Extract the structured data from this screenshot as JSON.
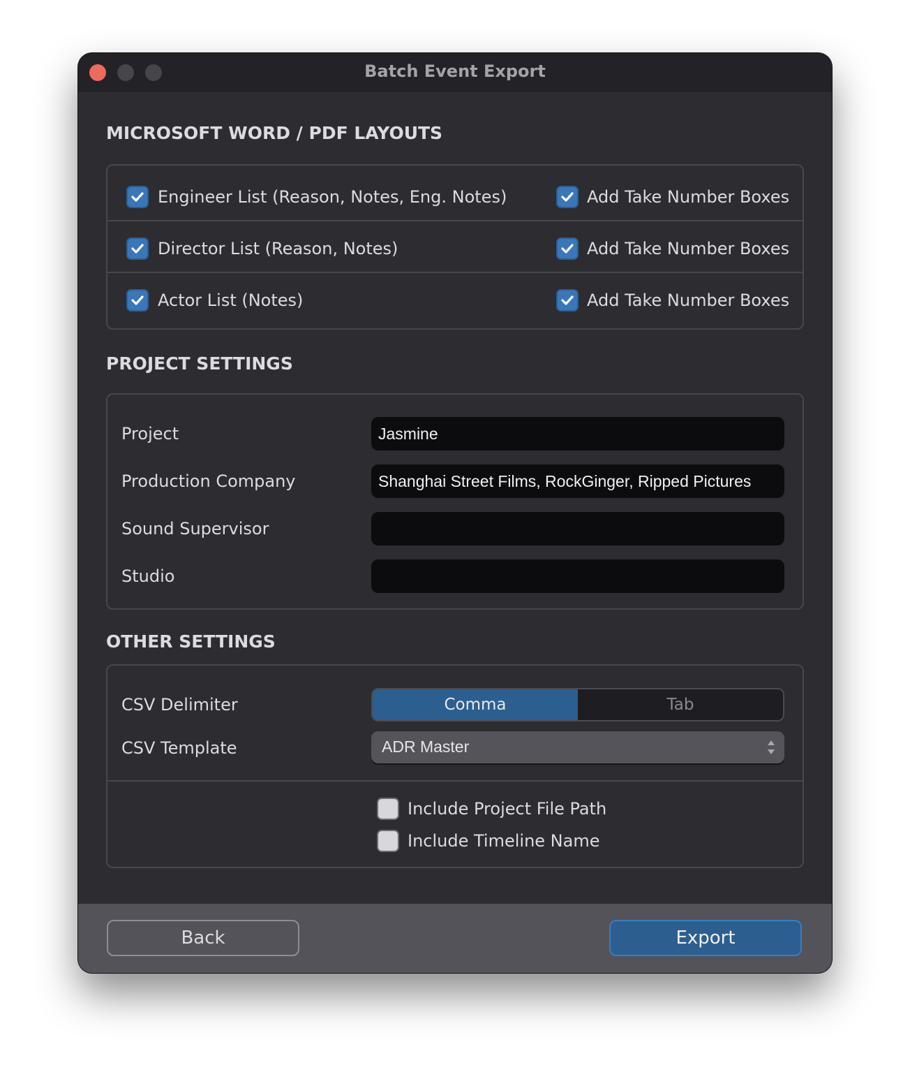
{
  "window": {
    "title": "Batch Event Export",
    "traffic_lights": [
      "close",
      "minimize",
      "zoom"
    ]
  },
  "layouts": {
    "heading": "MICROSOFT WORD / PDF LAYOUTS",
    "rows": [
      {
        "label": "Engineer List (Reason, Notes, Eng. Notes)",
        "checked": true,
        "take_label": "Add Take Number Boxes",
        "take_checked": true
      },
      {
        "label": "Director List (Reason, Notes)",
        "checked": true,
        "take_label": "Add Take Number Boxes",
        "take_checked": true
      },
      {
        "label": "Actor List (Notes)",
        "checked": true,
        "take_label": "Add Take Number Boxes",
        "take_checked": true
      }
    ]
  },
  "project": {
    "heading": "PROJECT SETTINGS",
    "fields": [
      {
        "label": "Project",
        "value": "Jasmine"
      },
      {
        "label": "Production Company",
        "value": "Shanghai Street Films, RockGinger, Ripped Pictures"
      },
      {
        "label": "Sound Supervisor",
        "value": ""
      },
      {
        "label": "Studio",
        "value": ""
      }
    ]
  },
  "other": {
    "heading": "OTHER SETTINGS",
    "delimiter_label": "CSV Delimiter",
    "delimiter_options": [
      "Comma",
      "Tab"
    ],
    "delimiter_selected": "Comma",
    "template_label": "CSV Template",
    "template_value": "ADR Master",
    "include_path_label": "Include Project File Path",
    "include_path_checked": false,
    "include_timeline_label": "Include Timeline Name",
    "include_timeline_checked": false
  },
  "footer": {
    "back_label": "Back",
    "export_label": "Export"
  },
  "colors": {
    "accent": "#2c5f90",
    "checkbox_on": "#3a77b8",
    "close_button": "#ec6a5e",
    "window_bg": "#2d2c31",
    "footer_bg": "#545359"
  }
}
